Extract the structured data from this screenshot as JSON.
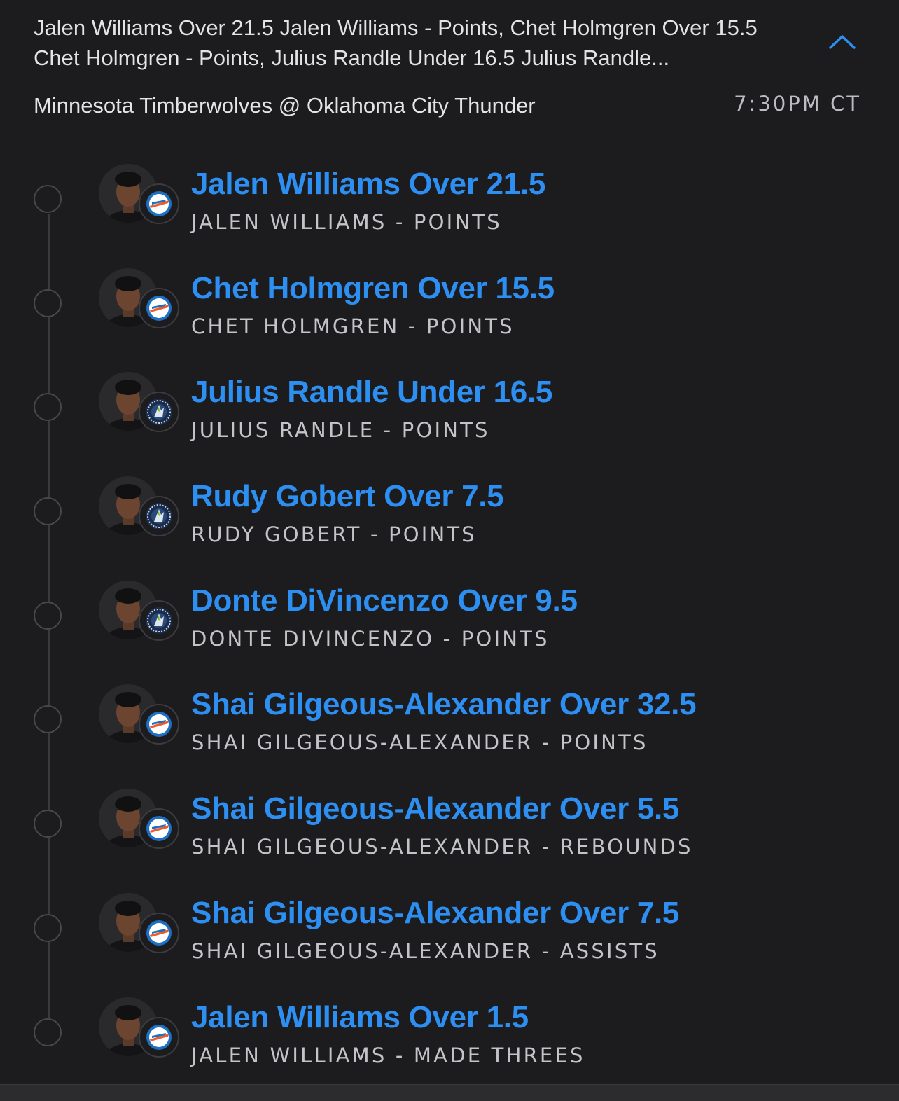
{
  "header": {
    "summary": "Jalen Williams Over 21.5 Jalen Williams - Points, Chet Holmgren Over 15.5 Chet Holmgren - Points, Julius Randle Under 16.5 Julius Randle...",
    "matchup": "Minnesota Timberwolves @ Oklahoma City Thunder",
    "time": "7:30PM CT",
    "collapse_icon": "chevron-up-icon"
  },
  "colors": {
    "accent": "#2d8ff2",
    "background": "#1c1c1e",
    "okc_blue": "#1d6fc2",
    "okc_orange": "#ef5a2a",
    "min_navy": "#1a2d4d",
    "min_green": "#78be20"
  },
  "legs": [
    {
      "title": "Jalen Williams Over 21.5",
      "subtitle": "JALEN WILLIAMS - POINTS",
      "team": "okc",
      "team_icon": "thunder-logo-icon",
      "avatar_icon": "player-headshot-icon"
    },
    {
      "title": "Chet Holmgren Over 15.5",
      "subtitle": "CHET HOLMGREN - POINTS",
      "team": "okc",
      "team_icon": "thunder-logo-icon",
      "avatar_icon": "player-headshot-icon"
    },
    {
      "title": "Julius Randle Under 16.5",
      "subtitle": "JULIUS RANDLE - POINTS",
      "team": "min",
      "team_icon": "timberwolves-logo-icon",
      "avatar_icon": "player-headshot-icon"
    },
    {
      "title": "Rudy Gobert Over 7.5",
      "subtitle": "RUDY GOBERT - POINTS",
      "team": "min",
      "team_icon": "timberwolves-logo-icon",
      "avatar_icon": "player-headshot-icon"
    },
    {
      "title": "Donte DiVincenzo Over 9.5",
      "subtitle": "DONTE DIVINCENZO - POINTS",
      "team": "min",
      "team_icon": "timberwolves-logo-icon",
      "avatar_icon": "player-headshot-icon"
    },
    {
      "title": "Shai Gilgeous-Alexander Over 32.5",
      "subtitle": "SHAI GILGEOUS-ALEXANDER - POINTS",
      "team": "okc",
      "team_icon": "thunder-logo-icon",
      "avatar_icon": "player-headshot-icon"
    },
    {
      "title": "Shai Gilgeous-Alexander Over 5.5",
      "subtitle": "SHAI GILGEOUS-ALEXANDER - REBOUNDS",
      "team": "okc",
      "team_icon": "thunder-logo-icon",
      "avatar_icon": "player-headshot-icon"
    },
    {
      "title": "Shai Gilgeous-Alexander Over 7.5",
      "subtitle": "SHAI GILGEOUS-ALEXANDER - ASSISTS",
      "team": "okc",
      "team_icon": "thunder-logo-icon",
      "avatar_icon": "player-headshot-icon"
    },
    {
      "title": "Jalen Williams Over 1.5",
      "subtitle": "JALEN WILLIAMS - MADE THREES",
      "team": "okc",
      "team_icon": "thunder-logo-icon",
      "avatar_icon": "player-headshot-icon"
    }
  ]
}
